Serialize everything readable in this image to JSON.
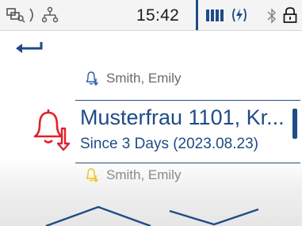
{
  "status_bar": {
    "time": "15:42",
    "icons": [
      "network-search-icon",
      "network-share-icon",
      "battery-icon",
      "charging-icon",
      "bluetooth-icon",
      "lock-icon"
    ],
    "accent_color": "#1f4b86"
  },
  "navigation": {
    "back_icon": "back-arrow-icon"
  },
  "alarm_list": {
    "previous_item": {
      "name": "Smith, Emily",
      "icon": "bell-down-icon",
      "icon_color": "#2c5fa6"
    },
    "selected_item": {
      "title": "Musterfrau 1101, Kr...",
      "subtitle": "Since 3 Days (2023.08.23)",
      "icon": "bell-down-icon",
      "icon_color": "#e0212b"
    },
    "next_item": {
      "name": "Smith, Emily",
      "icon": "bell-down-icon",
      "icon_color": "#f0c419"
    }
  },
  "footer": {
    "icons": [
      "chevron-up-icon",
      "chevron-down-icon"
    ]
  }
}
